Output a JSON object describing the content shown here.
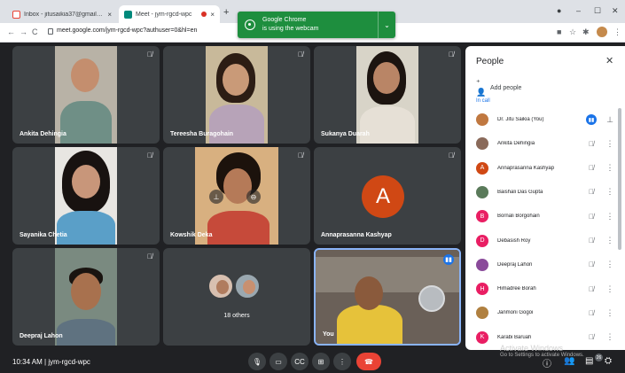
{
  "browser": {
    "tabs": [
      {
        "title": "Inbox - jitusaikia37@gmail.com",
        "close": "×"
      },
      {
        "title": "Meet - jym-rgcd-wpc",
        "close": "×"
      }
    ],
    "new_tab": "+",
    "window_controls": [
      "–",
      "☐",
      "✕"
    ],
    "nav": [
      "←",
      "→",
      "C"
    ],
    "url": "meet.google.com/jym-rgcd-wpc?authuser=0&hl=en",
    "toast": {
      "line1": "Google Chrome",
      "line2": "is using the webcam"
    }
  },
  "tiles": [
    {
      "name": "Ankita Dehingia"
    },
    {
      "name": "Tereesha Buragohain"
    },
    {
      "name": "Sukanya Duarah"
    },
    {
      "name": "Sayanika Chetia"
    },
    {
      "name": "Kowshik Deka"
    },
    {
      "name": "Annaprasanna Kashyap",
      "letter": "A"
    },
    {
      "name": "Deepraj Lahon"
    },
    {
      "name": "18 others"
    },
    {
      "name": "You"
    }
  ],
  "people_panel": {
    "title": "People",
    "add_people": "Add people",
    "section": "In call",
    "participants": [
      {
        "name": "Dr. Jitu Saikia (You)",
        "avatar": "photo",
        "color": "#c07840"
      },
      {
        "name": "Ankita Dehingia",
        "avatar": "photo",
        "color": "#8a6a5a"
      },
      {
        "name": "Annaprasanna Kashyap",
        "avatar": "A",
        "color": "#d04814"
      },
      {
        "name": "Baishali Das Gupta",
        "avatar": "photo",
        "color": "#5a7a5a"
      },
      {
        "name": "Bornali Borgohain",
        "avatar": "B",
        "color": "#e91e63"
      },
      {
        "name": "Debasish Roy",
        "avatar": "D",
        "color": "#e91e63"
      },
      {
        "name": "Deepraj Lahon",
        "avatar": "photo",
        "color": "#8a4a9a"
      },
      {
        "name": "Himadree Borah",
        "avatar": "H",
        "color": "#e91e63"
      },
      {
        "name": "Janmoni Gogoi",
        "avatar": "photo",
        "color": "#b08040"
      },
      {
        "name": "Karabi Baruah",
        "avatar": "K",
        "color": "#e91e63"
      }
    ]
  },
  "bottom": {
    "time": "10:34 AM",
    "separator": "|",
    "meeting_code": "jym-rgcd-wpc",
    "people_count": "26"
  },
  "watermark": {
    "line1": "Activate Windows",
    "line2": "Go to Settings to activate Windows."
  },
  "colors": {
    "accent": "#1a73e8",
    "end_call": "#ea4335",
    "toast": "#1e8e3e",
    "tile_bg": "#3c4043"
  }
}
